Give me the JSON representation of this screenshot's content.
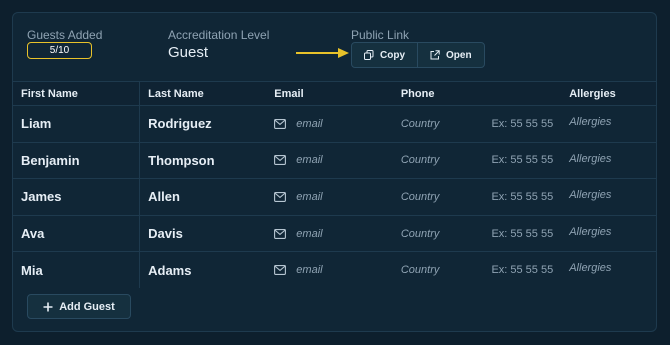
{
  "header": {
    "guests_added_label": "Guests Added",
    "guests_added_value": "5/10",
    "accreditation_label": "Accreditation Level",
    "accreditation_value": "Guest",
    "public_link_label": "Public Link",
    "copy_label": "Copy",
    "open_label": "Open"
  },
  "colors": {
    "accent": "#e8c22a",
    "background": "#0d1f2d",
    "panel": "#102636"
  },
  "table": {
    "columns": [
      "First Name",
      "Last Name",
      "Email",
      "Phone",
      "Allergies"
    ],
    "rows": [
      {
        "first": "Liam",
        "last": "Rodriguez",
        "email": "email",
        "country": "Country",
        "phone": "Ex: 55 55 55",
        "allergies": "Allergies"
      },
      {
        "first": "Benjamin",
        "last": "Thompson",
        "email": "email",
        "country": "Country",
        "phone": "Ex: 55 55 55",
        "allergies": "Allergies"
      },
      {
        "first": "James",
        "last": "Allen",
        "email": "email",
        "country": "Country",
        "phone": "Ex: 55 55 55",
        "allergies": "Allergies"
      },
      {
        "first": "Ava",
        "last": "Davis",
        "email": "email",
        "country": "Country",
        "phone": "Ex: 55 55 55",
        "allergies": "Allergies"
      },
      {
        "first": "Mia",
        "last": "Adams",
        "email": "email",
        "country": "Country",
        "phone": "Ex: 55 55 55",
        "allergies": "Allergies"
      }
    ]
  },
  "footer": {
    "add_guest_label": "Add Guest"
  }
}
